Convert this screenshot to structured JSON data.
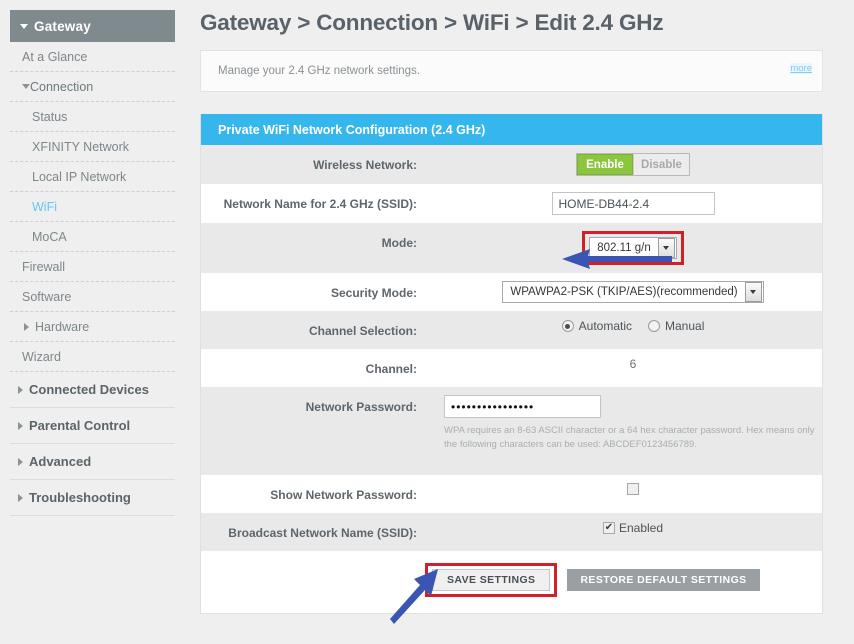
{
  "sidebar": {
    "gateway": {
      "label": "Gateway",
      "caret": "caret-down-icon"
    },
    "items": [
      {
        "label": "At a Glance",
        "level": 1,
        "caret": "",
        "active": false
      },
      {
        "label": "Connection",
        "level": 1,
        "caret": "caret-down-icon",
        "active": false
      },
      {
        "label": "Status",
        "level": 2,
        "caret": "",
        "active": false
      },
      {
        "label": "XFINITY Network",
        "level": 2,
        "caret": "",
        "active": false
      },
      {
        "label": "Local IP Network",
        "level": 2,
        "caret": "",
        "active": false
      },
      {
        "label": "WiFi",
        "level": 2,
        "caret": "",
        "active": true
      },
      {
        "label": "MoCA",
        "level": 2,
        "caret": "",
        "active": false
      },
      {
        "label": "Firewall",
        "level": 1,
        "caret": "",
        "active": false
      },
      {
        "label": "Software",
        "level": 1,
        "caret": "",
        "active": false
      },
      {
        "label": "Hardware",
        "level": 1,
        "caret": "caret-right-icon",
        "active": false
      },
      {
        "label": "Wizard",
        "level": 1,
        "caret": "",
        "active": false
      }
    ],
    "sections": [
      {
        "label": "Connected Devices",
        "caret": "caret-right-icon"
      },
      {
        "label": "Parental Control",
        "caret": "caret-right-icon"
      },
      {
        "label": "Advanced",
        "caret": "caret-right-icon"
      },
      {
        "label": "Troubleshooting",
        "caret": "caret-right-icon"
      }
    ]
  },
  "main": {
    "page_title": "Gateway > Connection > WiFi > Edit 2.4 GHz",
    "info_text": "Manage your 2.4 GHz network settings.",
    "more_label": "more",
    "panel_title": "Private WiFi Network Configuration (2.4 GHz)",
    "rows": {
      "wireless_network": {
        "label": "Wireless Network:",
        "enable_label": "Enable",
        "disable_label": "Disable",
        "selected": "Enable"
      },
      "ssid": {
        "label": "Network Name for 2.4 GHz (SSID):",
        "value": "HOME-DB44-2.4"
      },
      "mode": {
        "label": "Mode:",
        "value": "802.11 g/n",
        "highlighted": true
      },
      "security_mode": {
        "label": "Security Mode:",
        "value": "WPAWPA2-PSK (TKIP/AES)(recommended)"
      },
      "channel_selection": {
        "label": "Channel Selection:",
        "option_automatic": "Automatic",
        "option_manual": "Manual",
        "selected": "Automatic"
      },
      "channel": {
        "label": "Channel:",
        "value": "6"
      },
      "network_password": {
        "label": "Network Password:",
        "value": "••••••••••••••••",
        "help": "WPA requires an 8-63 ASCII character or a 64 hex character password. Hex means only the following characters can be used: ABCDEF0123456789."
      },
      "show_password": {
        "label": "Show Network Password:",
        "checked": false,
        "check_glyph": ""
      },
      "broadcast_ssid": {
        "label": "Broadcast Network Name (SSID):",
        "checked": true,
        "check_glyph": "✔",
        "value_label": "Enabled"
      }
    },
    "buttons": {
      "save": "SAVE SETTINGS",
      "restore": "RESTORE DEFAULT SETTINGS"
    }
  },
  "annotations": {
    "arrow_mode": "blue-left-arrow-icon",
    "arrow_save": "blue-diagonal-arrow-icon",
    "highlight_color": "#d0202a",
    "arrow_color": "#3b55b5"
  }
}
